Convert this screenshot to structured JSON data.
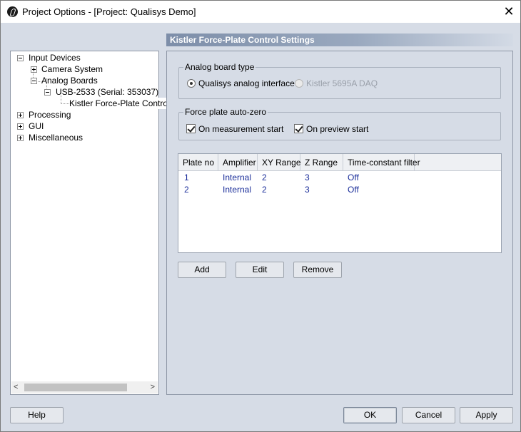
{
  "window": {
    "title": "Project Options - [Project: Qualisys Demo]",
    "close_symbol": "✕"
  },
  "tree": {
    "items": [
      {
        "label": "Input Devices",
        "state": "expanded"
      },
      {
        "label": "Camera System",
        "state": "collapsed"
      },
      {
        "label": "Analog Boards",
        "state": "expanded"
      },
      {
        "label": "USB-2533 (Serial: 353037)",
        "state": "expanded"
      },
      {
        "label": "Kistler Force-Plate Control",
        "state": "leaf",
        "selected": true
      },
      {
        "label": "Processing",
        "state": "collapsed"
      },
      {
        "label": "GUI",
        "state": "collapsed"
      },
      {
        "label": "Miscellaneous",
        "state": "collapsed"
      }
    ],
    "scroll_left": "<",
    "scroll_right": ">"
  },
  "settings": {
    "header": "Kistler Force-Plate Control Settings",
    "analog_board": {
      "title": "Analog board type",
      "option1": "Qualisys analog interface",
      "option2": "Kistler 5695A DAQ"
    },
    "autozero": {
      "title": "Force plate auto-zero",
      "option1": "On measurement start",
      "option2": "On preview start"
    },
    "table": {
      "columns": [
        "Plate no",
        "Amplifier",
        "XY Range",
        "Z Range",
        "Time-constant filter"
      ],
      "rows": [
        [
          "1",
          "Internal",
          "2",
          "3",
          "Off"
        ],
        [
          "2",
          "Internal",
          "2",
          "3",
          "Off"
        ]
      ]
    },
    "buttons": {
      "add": "Add",
      "edit": "Edit",
      "remove": "Remove"
    }
  },
  "footer": {
    "help": "Help",
    "ok": "OK",
    "cancel": "Cancel",
    "apply": "Apply"
  },
  "colors": {
    "background": "#d6dce6",
    "header_gradient_start": "#7d8ea9",
    "table_text": "#1b2e9a"
  }
}
